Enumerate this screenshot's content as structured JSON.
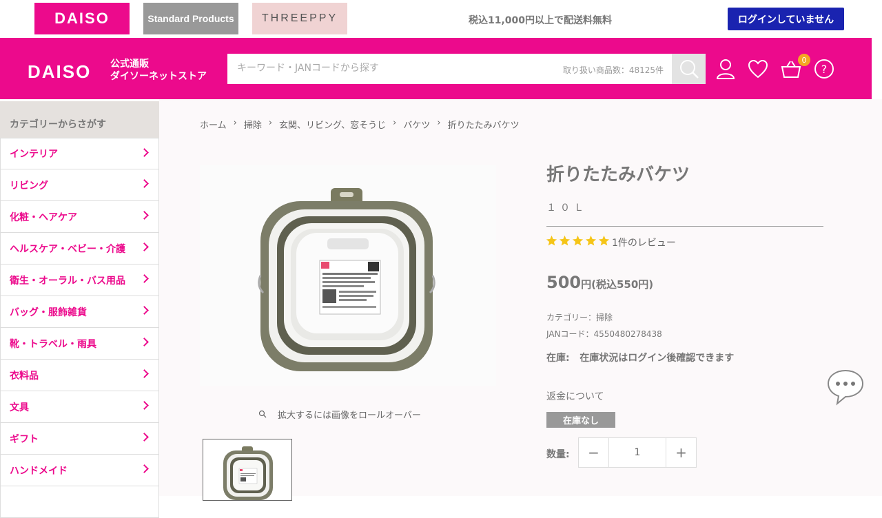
{
  "topbar": {
    "brand_daiso": "DAISO",
    "brand_standard": "Standard Products",
    "brand_threeppy": "THREEPPY",
    "shipping_note": "税込11,000円以上で配送料無料",
    "login_label": "ログインしていません"
  },
  "header": {
    "logo": "DAISO",
    "logo_sub1": "公式通販",
    "logo_sub2": "ダイソーネットストア",
    "search_placeholder": "キーワード・JANコードから探す",
    "product_count": "取り扱い商品数：48125件",
    "cart_count": "0"
  },
  "sidebar": {
    "heading": "カテゴリーからさがす",
    "items": [
      {
        "label": "インテリア"
      },
      {
        "label": "リビング"
      },
      {
        "label": "化粧・ヘアケア"
      },
      {
        "label": "ヘルスケア・ベビー・介護"
      },
      {
        "label": "衛生・オーラル・バス用品"
      },
      {
        "label": "バッグ・服飾雑貨"
      },
      {
        "label": "靴・トラベル・雨具"
      },
      {
        "label": "衣料品"
      },
      {
        "label": "文具"
      },
      {
        "label": "ギフト"
      },
      {
        "label": "ハンドメイド"
      }
    ]
  },
  "breadcrumb": [
    "ホーム",
    "掃除",
    "玄関、リビング、窓そうじ",
    "バケツ",
    "折りたたみバケツ"
  ],
  "product": {
    "title": "折りたたみバケツ",
    "variant": "１０Ｌ",
    "rating": 5,
    "review_count": "1件のレビュー",
    "price_main": "500",
    "price_suffix": "円(税込550円)",
    "category": "カテゴリー：掃除",
    "jan": "JANコード：4550480278438",
    "stock": "在庫:   在庫状況はログイン後確認できます",
    "refund": "返金について",
    "oos_badge": "在庫なし",
    "qty_label": "数量:",
    "qty_value": "1",
    "zoom_note": "拡大するには画像をロールオーバー"
  },
  "colors": {
    "brand_pink": "#ec0a8c",
    "login_blue": "#1a23b0",
    "star": "#f5c518"
  }
}
